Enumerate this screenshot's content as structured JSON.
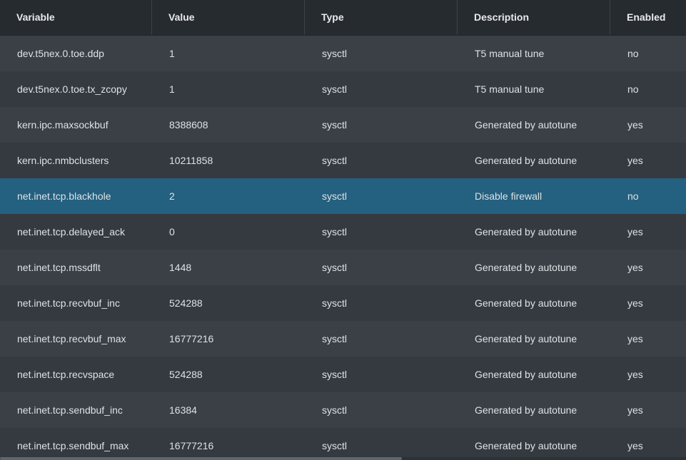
{
  "columns": [
    "Variable",
    "Value",
    "Type",
    "Description",
    "Enabled"
  ],
  "rows": [
    {
      "variable": "dev.t5nex.0.toe.ddp",
      "value": "1",
      "type": "sysctl",
      "description": "T5 manual tune",
      "enabled": "no"
    },
    {
      "variable": "dev.t5nex.0.toe.tx_zcopy",
      "value": "1",
      "type": "sysctl",
      "description": "T5 manual tune",
      "enabled": "no"
    },
    {
      "variable": "kern.ipc.maxsockbuf",
      "value": "8388608",
      "type": "sysctl",
      "description": "Generated by autotune",
      "enabled": "yes"
    },
    {
      "variable": "kern.ipc.nmbclusters",
      "value": "10211858",
      "type": "sysctl",
      "description": "Generated by autotune",
      "enabled": "yes"
    },
    {
      "variable": "net.inet.tcp.blackhole",
      "value": "2",
      "type": "sysctl",
      "description": "Disable firewall",
      "enabled": "no"
    },
    {
      "variable": "net.inet.tcp.delayed_ack",
      "value": "0",
      "type": "sysctl",
      "description": "Generated by autotune",
      "enabled": "yes"
    },
    {
      "variable": "net.inet.tcp.mssdflt",
      "value": "1448",
      "type": "sysctl",
      "description": "Generated by autotune",
      "enabled": "yes"
    },
    {
      "variable": "net.inet.tcp.recvbuf_inc",
      "value": "524288",
      "type": "sysctl",
      "description": "Generated by autotune",
      "enabled": "yes"
    },
    {
      "variable": "net.inet.tcp.recvbuf_max",
      "value": "16777216",
      "type": "sysctl",
      "description": "Generated by autotune",
      "enabled": "yes"
    },
    {
      "variable": "net.inet.tcp.recvspace",
      "value": "524288",
      "type": "sysctl",
      "description": "Generated by autotune",
      "enabled": "yes"
    },
    {
      "variable": "net.inet.tcp.sendbuf_inc",
      "value": "16384",
      "type": "sysctl",
      "description": "Generated by autotune",
      "enabled": "yes"
    },
    {
      "variable": "net.inet.tcp.sendbuf_max",
      "value": "16777216",
      "type": "sysctl",
      "description": "Generated by autotune",
      "enabled": "yes"
    }
  ],
  "selected_row": 4,
  "colors": {
    "header_bg": "#262b30",
    "row_odd": "#3a4046",
    "row_even": "#343a40",
    "row_selected": "#24607f"
  }
}
